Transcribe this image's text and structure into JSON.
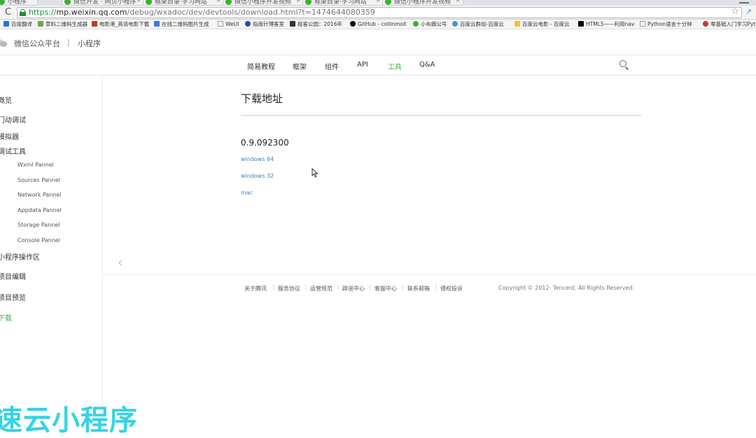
{
  "browser": {
    "tabs": [
      {
        "label": "小程序"
      },
      {
        "label": "微信开发 · 网页小程序"
      },
      {
        "label": "框架目录·学习网站"
      },
      {
        "label": "微信小程序开发视频"
      },
      {
        "label": "框架目录·学习网站"
      },
      {
        "label": "微信小程序开发视频"
      }
    ],
    "url": {
      "scheme": "https://",
      "host": "mp.weixin.qq.com",
      "path": "/debug/wxadoc/dev/devtools/download.html?t=1474644080359"
    },
    "bookmarks": [
      {
        "label": "百度翻译",
        "color": "#2f6fd6"
      },
      {
        "label": "草料二维码生成器",
        "color": "#6aa84f"
      },
      {
        "label": "电影港_高清电影下载",
        "color": "#c0392b"
      },
      {
        "label": "在线二维码图片生成",
        "color": "#3b78e7"
      },
      {
        "label": "WeUI",
        "color": "#999999"
      },
      {
        "label": "指南针博客室",
        "color": "#1f4e99"
      },
      {
        "label": "极客公园：2016年",
        "color": "#333333"
      },
      {
        "label": "GitHub - collinmoll",
        "color": "#111111"
      },
      {
        "label": "小布朗公号",
        "color": "#3cb034"
      },
      {
        "label": "百度云群组-百度云",
        "color": "#4a90d9"
      },
      {
        "label": "百度云电影 - 百度云",
        "color": "#f1c232"
      },
      {
        "label": "HTML5——利用nav",
        "color": "#000000"
      },
      {
        "label": "Python语言十分钟",
        "color": "#999999"
      },
      {
        "label": "零基础入门学习Pyt",
        "color": "#c0392b"
      }
    ]
  },
  "header": {
    "platform": "微信公众平台",
    "separator": "|",
    "section": "小程序"
  },
  "nav": [
    {
      "label": "简易教程",
      "active": false
    },
    {
      "label": "框架",
      "active": false
    },
    {
      "label": "组件",
      "active": false
    },
    {
      "label": "API",
      "active": false
    },
    {
      "label": "工具",
      "active": true
    },
    {
      "label": "Q&A",
      "active": false
    }
  ],
  "sidebar": [
    {
      "label": "概览"
    },
    {
      "label": "门动调试"
    },
    {
      "label": "模拟器"
    },
    {
      "label": "调试工具"
    },
    {
      "label": "Wxml Pannel"
    },
    {
      "label": "Sources Pannel"
    },
    {
      "label": "Network Pannel"
    },
    {
      "label": "Appdata Pannel"
    },
    {
      "label": "Storage Pannel"
    },
    {
      "label": "Console Pannel"
    },
    {
      "label": "小程序操作区"
    },
    {
      "label": "项目编辑"
    },
    {
      "label": "项目预览"
    },
    {
      "label": "下载"
    }
  ],
  "main": {
    "title": "下载地址",
    "version": "0.9.092300",
    "downloads": [
      "windows 64",
      "windows 32",
      "mac"
    ]
  },
  "footer": {
    "links": [
      "关于腾讯",
      "服务协议",
      "运营规范",
      "辟谣中心",
      "客服中心",
      "联系邮箱",
      "侵权投诉"
    ],
    "copyright": "Copyright © 2012- Tencent. All Rights Reserved."
  },
  "watermark": "速云小程序",
  "colors": {
    "accent": "#44b549",
    "link": "#4a7bb7",
    "watermark": "#37d3e3",
    "secure": "#1e8e3e"
  }
}
